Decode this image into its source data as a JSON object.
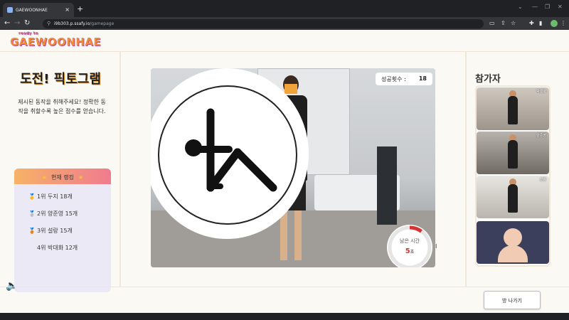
{
  "browser": {
    "tab_title": "GAEWOONHAE",
    "new_tab": "+",
    "close": "×",
    "url_host": "i9b303.p.ssafy.io",
    "url_path": "/gamepage"
  },
  "header": {
    "logo": "GAEWOONHAE",
    "logo_small": "ready to"
  },
  "challenge": {
    "title": "도전! 픽토그램",
    "instruction": "제시된 동작을 취해주세요! 정확한 동작을 취할수록 높은 점수를 얻습니다."
  },
  "ranking": {
    "title": "현재 랭킹",
    "items": [
      {
        "medal": "🥇",
        "text": "1위 두지 18개"
      },
      {
        "medal": "🥈",
        "text": "2위 양준영 15개"
      },
      {
        "medal": "🥉",
        "text": "3위 설랑 15개"
      },
      {
        "medal": "",
        "text": "4위 박대화 12개"
      }
    ]
  },
  "game": {
    "success_label": "성공횟수 :",
    "success_count": "18",
    "timer_label": "남은 시간",
    "timer_value": "5",
    "timer_unit": "초",
    "timer_progress": 0.1
  },
  "participants": {
    "title": "참가자",
    "tiles": [
      {
        "name": "박대화"
      },
      {
        "name": "양준영"
      },
      {
        "name": "설랑"
      },
      {
        "name": ""
      }
    ]
  },
  "footer": {
    "exit_label": "방 나가기"
  },
  "colors": {
    "accent": "#f08a3c",
    "timer_red": "#d33333",
    "rank_gradient_start": "#f7b267",
    "rank_gradient_end": "#f07b8f"
  }
}
